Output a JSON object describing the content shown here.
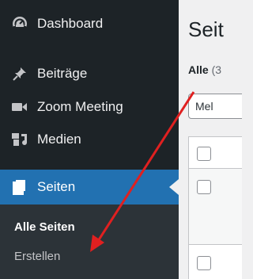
{
  "sidebar": {
    "items": [
      {
        "label": "Dashboard",
        "icon": "dashboard-icon"
      },
      {
        "label": "Beiträge",
        "icon": "pin-icon"
      },
      {
        "label": "Zoom Meeting",
        "icon": "video-camera-icon"
      },
      {
        "label": "Medien",
        "icon": "media-icon"
      },
      {
        "label": "Seiten",
        "icon": "pages-icon",
        "active": true
      }
    ],
    "submenu": [
      {
        "label": "Alle Seiten",
        "current": true
      },
      {
        "label": "Erstellen"
      }
    ]
  },
  "main": {
    "title": "Seit",
    "filter": {
      "current": "Alle",
      "count": "(3"
    },
    "bulk_action": "Mel"
  },
  "colors": {
    "sidebar_bg": "#1d2327",
    "active_bg": "#2271b1",
    "submenu_bg": "#2c3338",
    "annotation_arrow": "#e02020"
  },
  "annotation": {
    "type": "arrow",
    "from": "main-area",
    "to": "Erstellen"
  }
}
